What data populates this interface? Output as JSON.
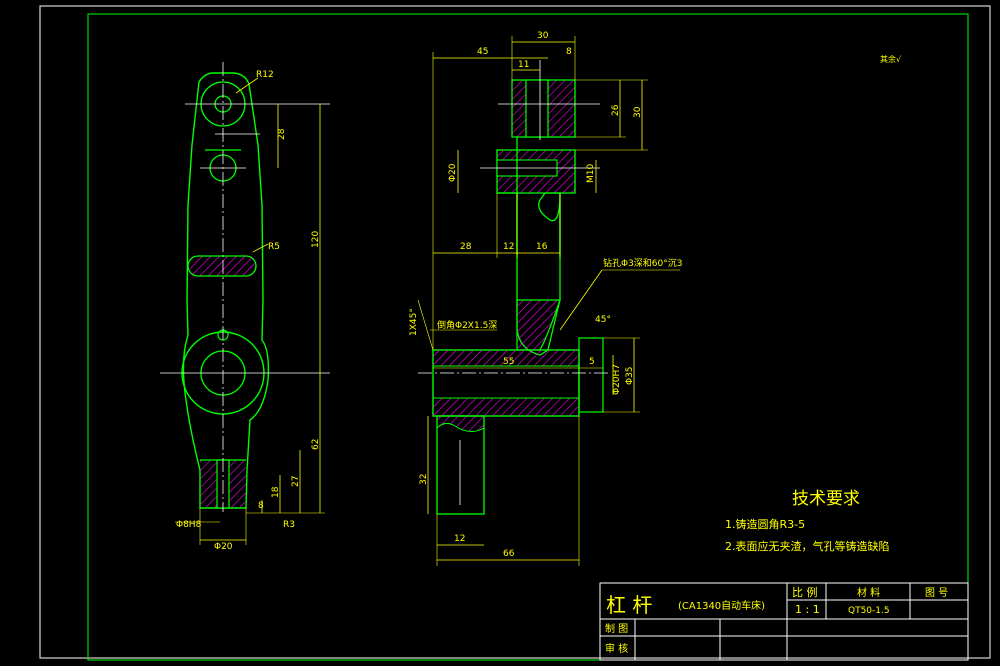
{
  "colors": {
    "background": "#000000",
    "frame": "#ffffff",
    "border": "#00ff00",
    "outline": "#00ff00",
    "centerline": "#ffffff",
    "dimension": "#ffff00",
    "hatch": "#ff00ff"
  },
  "left_view": {
    "radius_top": "R12",
    "dim_28": "28",
    "dim_120": "120",
    "slot_radius": "R5",
    "dim_62": "62",
    "dim_27": "27",
    "dim_18": "18",
    "dim_8": "8",
    "dim_r3": "R3",
    "hole_fit": "Φ8H8",
    "dia_20": "Φ20"
  },
  "section_view": {
    "dim_45": "45",
    "dim_30": "30",
    "dim_8": "8",
    "dim_11": "11",
    "dim_26": "26",
    "dim_30_right": "30",
    "dim_m10": "M10",
    "dim_phi20": "Φ20",
    "dim_28": "28",
    "dim_12": "12",
    "dim_16": "16",
    "note_drill": "钻孔Φ3深和60°沉3",
    "chamfer_note": "1X45°",
    "chamfer_note2": "倒角Φ2X1.5深",
    "dim_45deg": "45°",
    "dim_55": "55",
    "dim_5": "5",
    "fit_20h7": "Φ20H7",
    "dia_35": "Φ35",
    "dim_32": "32",
    "dim_12_bottom": "12",
    "dim_66": "66"
  },
  "roughness_mark": "其余√",
  "technical_requirements": {
    "title": "技术要求",
    "items": [
      "1.铸造圆角R3-5",
      "2.表面应无夹渣，气孔等铸造缺陷"
    ]
  },
  "title_block": {
    "part_name": "杠  杆",
    "subtitle": "(CA1340自动车床)",
    "scale_label": "比 例",
    "scale_value": "1 : 1",
    "material_label": "材 料",
    "material_value": "QT50-1.5",
    "drawing_no_label": "图 号",
    "drawn_label": "制 图",
    "checked_label": "审 核"
  }
}
